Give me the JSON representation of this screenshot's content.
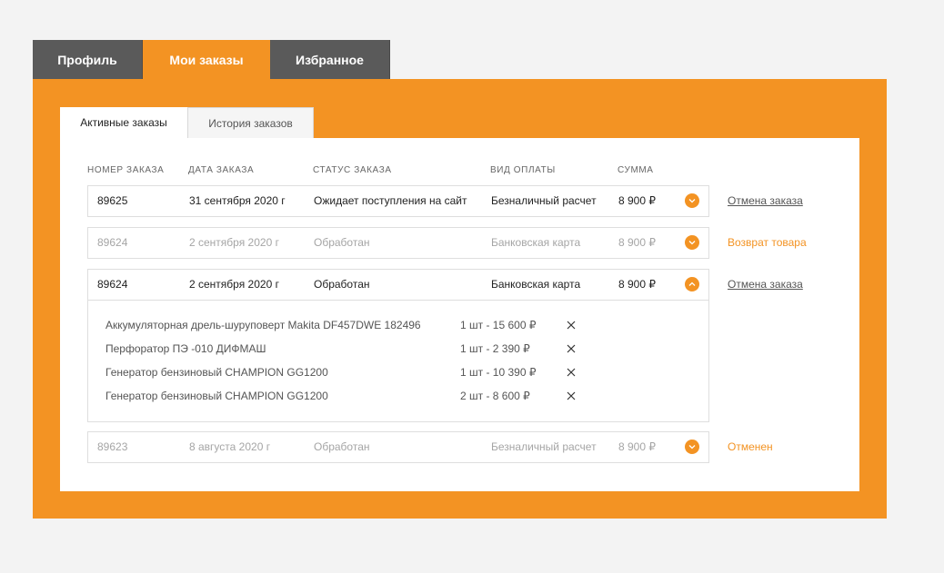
{
  "tabs": [
    {
      "label": "Профиль"
    },
    {
      "label": "Мои заказы"
    },
    {
      "label": "Избранное"
    }
  ],
  "subtabs": [
    {
      "label": "Активные заказы"
    },
    {
      "label": "История заказов"
    }
  ],
  "columns": {
    "number": "НОМЕР ЗАКАЗА",
    "date": "ДАТА ЗАКАЗА",
    "status": "СТАТУС ЗАКАЗА",
    "payment": "ВИД ОПЛАТЫ",
    "sum": "СУММА"
  },
  "orders": [
    {
      "number": "89625",
      "date": "31 сентября 2020 г",
      "status": "Ожидает поступления на сайт",
      "payment": "Безналичный расчет",
      "sum": "8 900 ₽",
      "action": "Отмена заказа"
    },
    {
      "number": "89624",
      "date": "2 сентября 2020 г",
      "status": "Обработан",
      "payment": "Банковская карта",
      "sum": "8 900 ₽",
      "action": "Возврат товара"
    },
    {
      "number": "89624",
      "date": "2 сентября 2020 г",
      "status": "Обработан",
      "payment": "Банковская карта",
      "sum": "8 900 ₽",
      "action": "Отмена заказа",
      "items": [
        {
          "name": "Аккумуляторная дрель-шуруповерт Makita DF457DWE  182496",
          "qty": "1 шт - 15 600 ₽"
        },
        {
          "name": "Перфоратор ПЭ -010 ДИФМАШ",
          "qty": "1 шт - 2 390 ₽"
        },
        {
          "name": "Генератор бензиновый CHAMPION GG1200",
          "qty": "1 шт - 10 390 ₽"
        },
        {
          "name": "Генератор бензиновый CHAMPION GG1200",
          "qty": "2 шт - 8 600 ₽"
        }
      ]
    },
    {
      "number": "89623",
      "date": "8 августа 2020 г",
      "status": "Обработан",
      "payment": "Безналичный расчет",
      "sum": "8 900 ₽",
      "action": "Отменен"
    }
  ],
  "icons": {
    "expand": "chevron-down-icon",
    "collapse": "chevron-up-icon",
    "remove": "close-icon"
  },
  "colors": {
    "accent": "#f39323",
    "tab_dark": "#5a5a5a",
    "background": "#f3f3f3"
  }
}
